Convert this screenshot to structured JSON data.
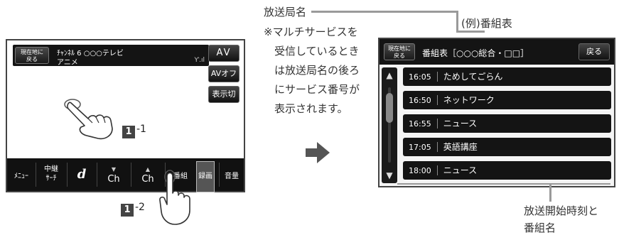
{
  "screen1": {
    "genzai_btn": "現在地に\n戻る",
    "channel_line1": "ﾁｬﾝﾈﾙ 6  ○○○テレビ",
    "channel_line2": "アニメ",
    "antenna": "Ƴ.ıl",
    "side_buttons": {
      "av": "AV",
      "avoff": "AVオフ",
      "hyoji": "表示切換"
    },
    "bottom": {
      "menu": "ﾒﾆｭｰ",
      "chukei1": "中継",
      "chukei2": "ｻｰﾁ",
      "d": "d",
      "ch_down_arrow": "▼",
      "ch_down": "Ch",
      "ch_up_arrow": "▲",
      "ch_up": "Ch",
      "bangumi": "番組",
      "rokuga": "録画",
      "onryo": "音量"
    }
  },
  "screen2": {
    "genzai_btn": "現在地に\n戻る",
    "title": "番組表［○○○総合・□□］",
    "back": "戻る",
    "scroll_up": "▲",
    "scroll_down": "▼",
    "programs": [
      {
        "time": "16:05",
        "name": "ためしてごらん"
      },
      {
        "time": "16:50",
        "name": "ネットワーク"
      },
      {
        "time": "16:55",
        "name": "ニュース"
      },
      {
        "time": "17:05",
        "name": "英語講座"
      },
      {
        "time": "18:00",
        "name": "ニュース"
      }
    ]
  },
  "annotations": {
    "station_name": "放送局名",
    "note_lines": [
      "※マルチサービスを",
      "受信しているとき",
      "は放送局名の後ろ",
      "にサービス番号が",
      "表示されます。"
    ],
    "example": "(例)番組表",
    "start_time_1": "放送開始時刻と",
    "start_time_2": "番組名",
    "step1_num": "1",
    "step1_sub": "-1",
    "step2_num": "1",
    "step2_sub": "-2"
  },
  "colors": {
    "screen_bar": "#141414",
    "annotation_line": "#9a9a9a",
    "badge": "#444444"
  }
}
